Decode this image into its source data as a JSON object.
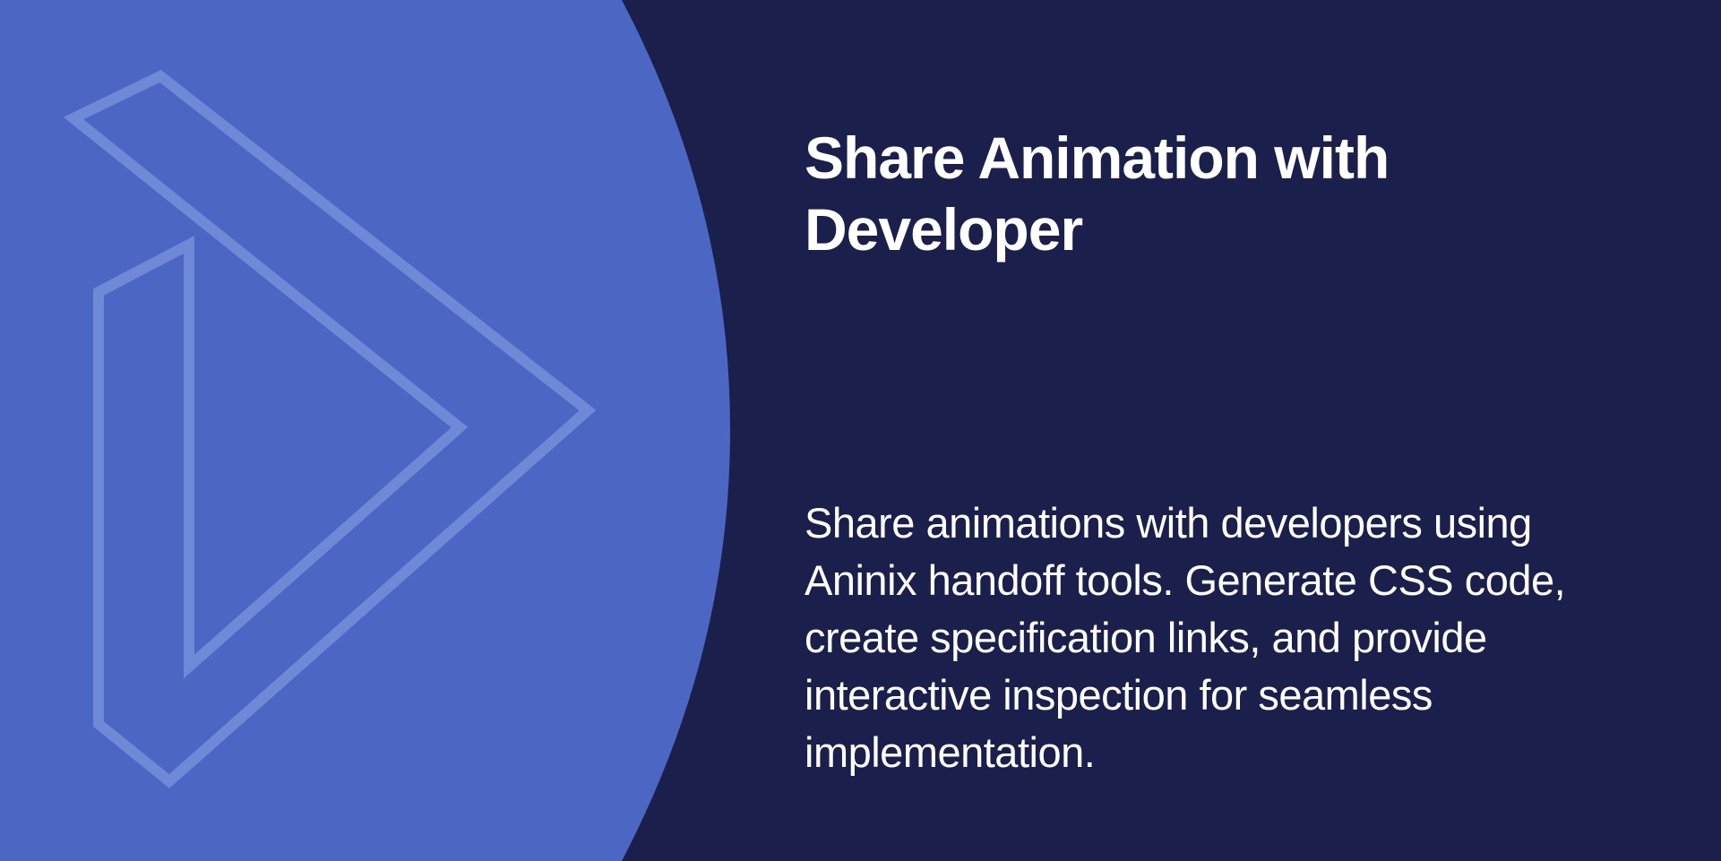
{
  "hero": {
    "title": "Share Animation with Developer",
    "description": "Share animations with developers using Aninix handoff tools. Generate CSS code, create specification links, and provide interactive inspection for seamless implementation.",
    "graphic_icon": "play-chevron-outline-icon"
  },
  "colors": {
    "background": "#1b1f4b",
    "accent": "#4c66c4",
    "outline": "#7089d7",
    "text": "#ffffff"
  }
}
